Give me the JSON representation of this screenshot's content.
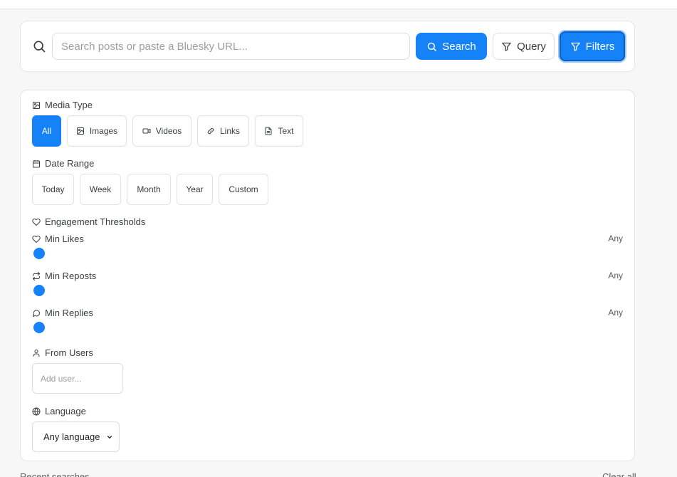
{
  "search": {
    "placeholder": "Search posts or paste a Bluesky URL...",
    "value": "",
    "search_label": "Search",
    "query_label": "Query",
    "filters_label": "Filters"
  },
  "filters": {
    "media_type": {
      "label": "Media Type",
      "options": [
        "All",
        "Images",
        "Videos",
        "Links",
        "Text"
      ],
      "selected": "All"
    },
    "date_range": {
      "label": "Date Range",
      "options": [
        "Today",
        "Week",
        "Month",
        "Year",
        "Custom"
      ]
    },
    "engagement": {
      "label": "Engagement Thresholds",
      "min_likes": {
        "label": "Min Likes",
        "value_label": "Any",
        "value": 0
      },
      "min_reposts": {
        "label": "Min Reposts",
        "value_label": "Any",
        "value": 0
      },
      "min_replies": {
        "label": "Min Replies",
        "value_label": "Any",
        "value": 0
      }
    },
    "from_users": {
      "label": "From Users",
      "placeholder": "Add user..."
    },
    "language": {
      "label": "Language",
      "selected": "Any language"
    }
  },
  "recent": {
    "label": "Recent searches",
    "clear_label": "Clear all"
  },
  "colors": {
    "accent": "#1583f7",
    "border": "#e4e5e8",
    "background": "#f7f7f8"
  },
  "icons": {
    "search": "search-icon",
    "query": "filter-icon",
    "filters": "filter-icon",
    "media": "image-icon",
    "video": "video-icon",
    "link": "link-icon",
    "text": "file-text-icon",
    "date": "calendar-icon",
    "engagement": "heart-icon",
    "reposts": "repeat-icon",
    "replies": "message-circle-icon",
    "user": "user-icon",
    "language": "globe-icon"
  }
}
